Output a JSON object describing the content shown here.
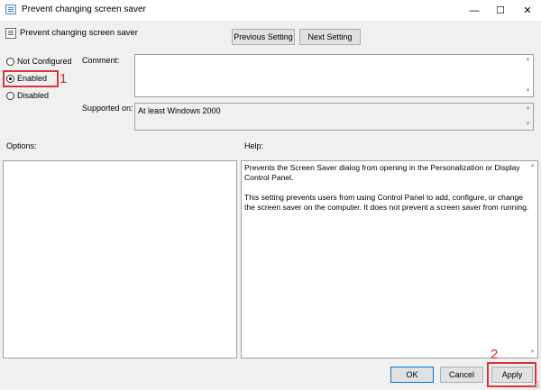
{
  "window": {
    "title": "Prevent changing screen saver",
    "minimize_glyph": "—",
    "maximize_glyph": "☐",
    "close_glyph": "✕"
  },
  "header": {
    "policy_name": "Prevent changing screen saver",
    "previous_label": "Previous Setting",
    "next_label": "Next Setting"
  },
  "state": {
    "options": [
      {
        "label": "Not Configured",
        "selected": false
      },
      {
        "label": "Enabled",
        "selected": true
      },
      {
        "label": "Disabled",
        "selected": false
      }
    ]
  },
  "comment": {
    "label": "Comment:",
    "value": ""
  },
  "supported": {
    "label": "Supported on:",
    "value": "At least Windows 2000"
  },
  "options_panel": {
    "label": "Options:"
  },
  "help_panel": {
    "label": "Help:",
    "paragraph1": "Prevents the Screen Saver dialog from opening in the Personalization or Display Control Panel.",
    "paragraph2": "This setting prevents users from using Control Panel to add, configure, or change the screen saver on the computer. It does not prevent a screen saver from running."
  },
  "footer": {
    "ok_label": "OK",
    "cancel_label": "Cancel",
    "apply_label": "Apply"
  },
  "annotations": {
    "step1": "1",
    "step2": "2",
    "color": "#d9343a"
  }
}
